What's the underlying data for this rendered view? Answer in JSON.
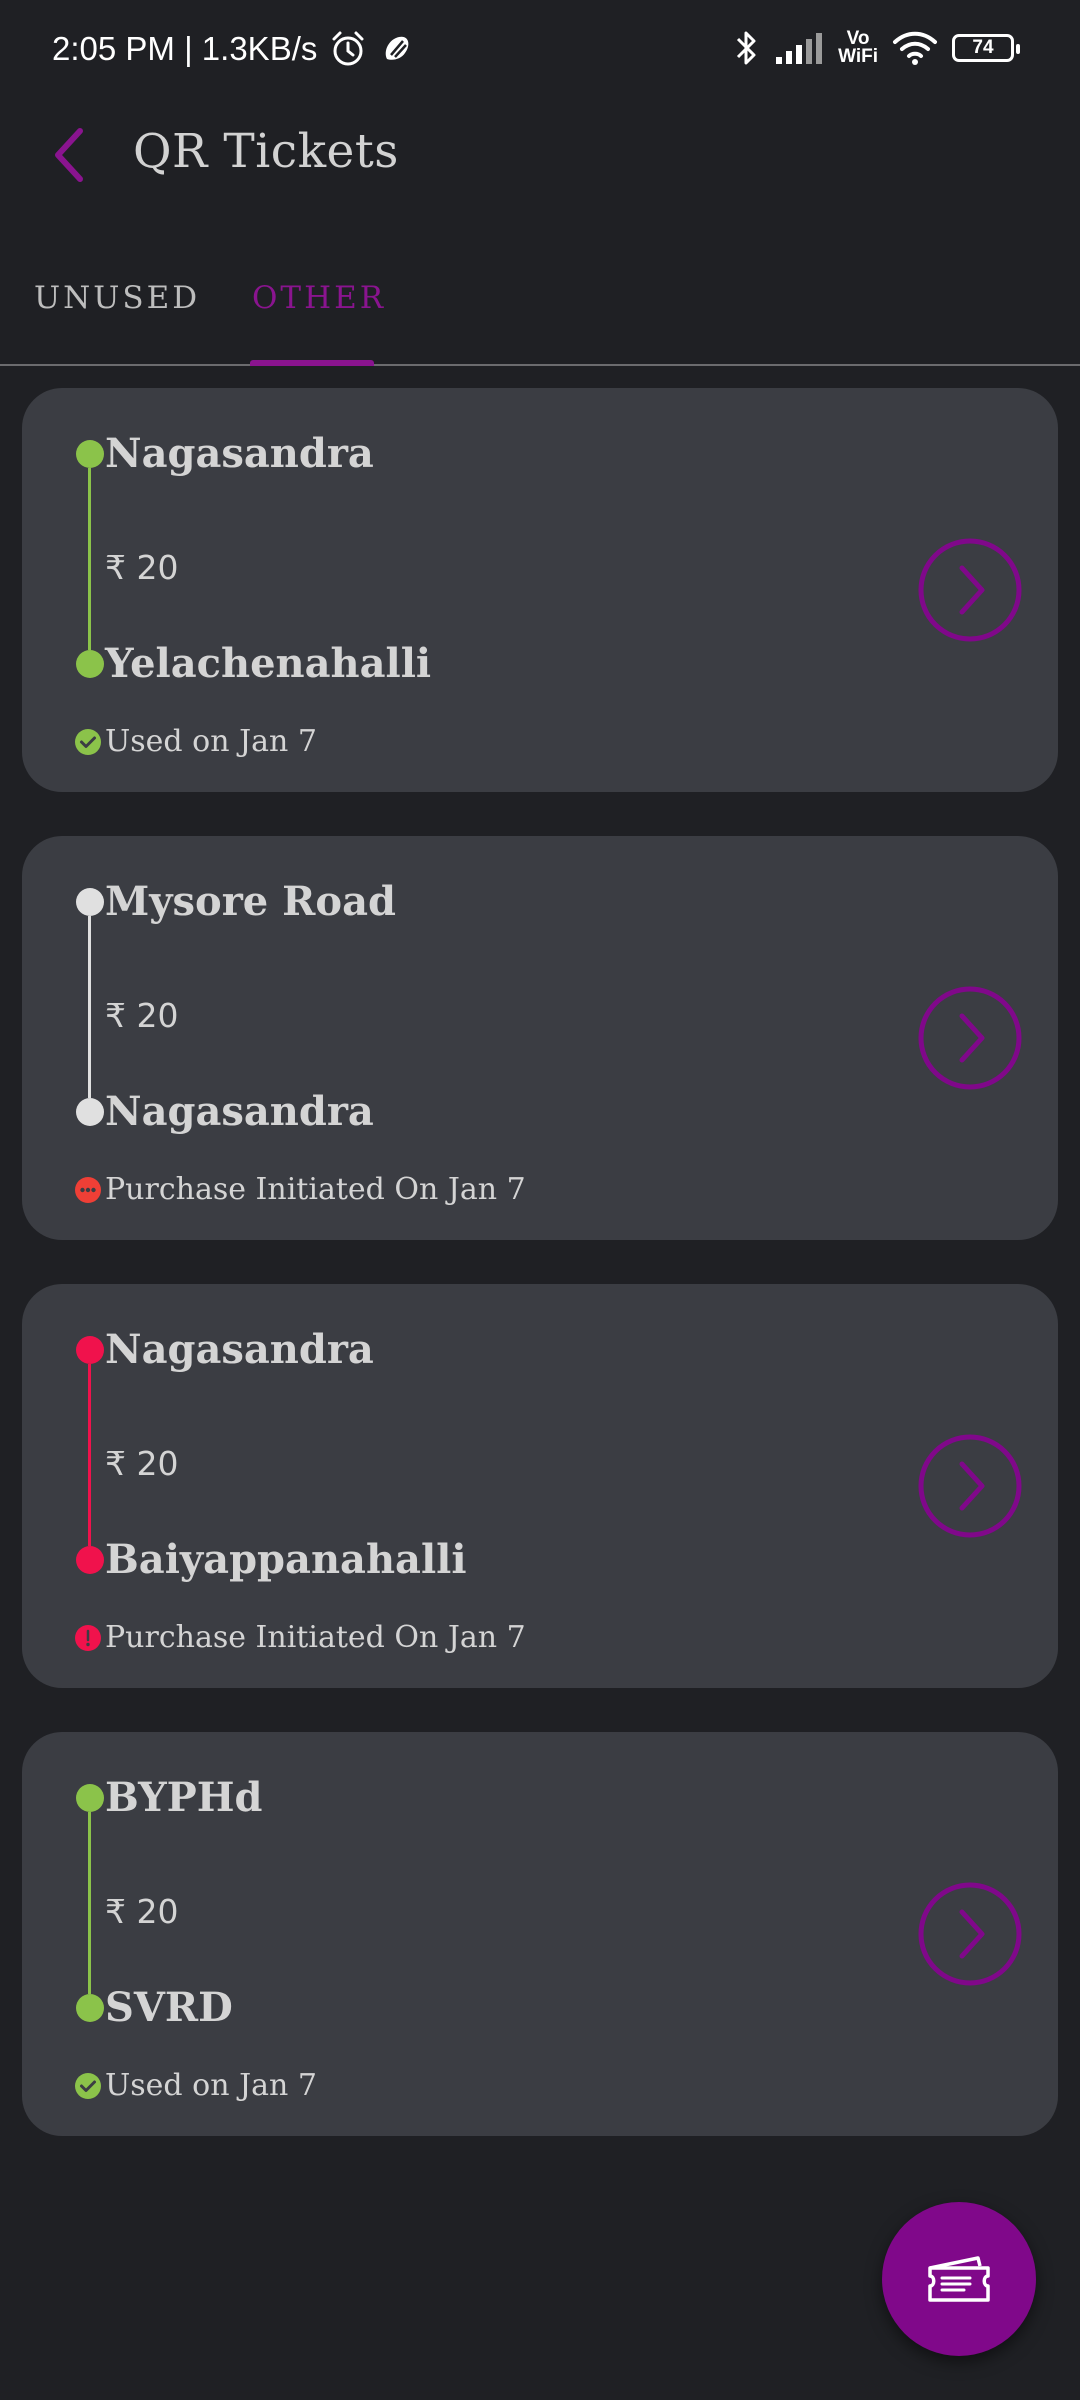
{
  "status_bar": {
    "time_speed": "2:05 PM | 1.3KB/s",
    "vowifi_top": "Vo",
    "vowifi_bottom": "WiFi",
    "battery": "74"
  },
  "header": {
    "title": "QR Tickets"
  },
  "tabs": [
    {
      "label": "UNUSED",
      "selected": false
    },
    {
      "label": "OTHER",
      "selected": true
    }
  ],
  "colors": {
    "accent": "#8a148f",
    "green": "#8bc34a",
    "white": "#e0e0e0",
    "red": "#f0124c",
    "orange_red": "#ef3f36"
  },
  "tickets": [
    {
      "from": "Nagasandra",
      "to": "Yelachenahalli",
      "fare": "₹ 20",
      "status": "Used on Jan 7",
      "status_icon": "check-circle-icon",
      "route_color": "#8bc34a"
    },
    {
      "from": "Mysore Road",
      "to": "Nagasandra",
      "fare": "₹ 20",
      "status": "Purchase Initiated On Jan 7",
      "status_icon": "more-dots-icon",
      "route_color": "#e0e0e0"
    },
    {
      "from": "Nagasandra",
      "to": "Baiyappanahalli",
      "fare": "₹ 20",
      "status": "Purchase Initiated On Jan 7",
      "status_icon": "alert-circle-icon",
      "route_color": "#f0124c"
    },
    {
      "from": "BYPHd",
      "to": "SVRD",
      "fare": "₹ 20",
      "status": "Used on Jan 7",
      "status_icon": "check-circle-icon",
      "route_color": "#8bc34a"
    }
  ],
  "fab": {
    "icon": "ticket-icon"
  }
}
